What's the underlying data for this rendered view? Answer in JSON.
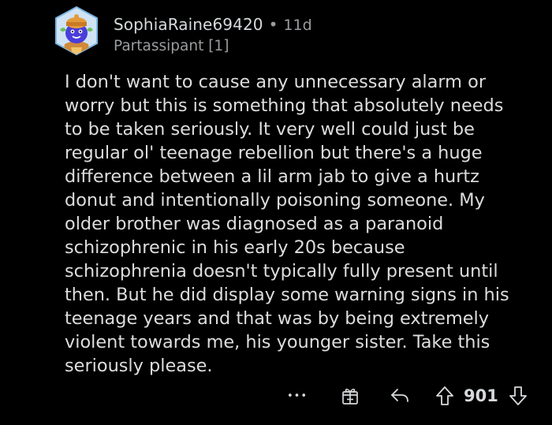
{
  "comment": {
    "username": "SophiaRaine69420",
    "separator": "•",
    "age": "11d",
    "flair": "Partassipant [1]",
    "body_lines": [
      "I don't want to cause any unnecessary alarm or",
      "worry but this is something that absolutely needs",
      "to be taken seriously. It very well could just be",
      "regular ol' teenage rebellion but there's a huge",
      "difference between a lil arm jab to give a hurtz",
      "donut and intentionally poisoning someone. My",
      "older brother was diagnosed as a paranoid",
      "schizophrenic in his early 20s because",
      "schizophrenia doesn't typically fully present until",
      "then. But he did display some warning signs in his",
      "teenage years and that was by being extremely",
      "violent towards me, his younger sister. Take this",
      "seriously please."
    ]
  },
  "actions": {
    "more_label": "•••",
    "score": "901",
    "icons": {
      "more": "more-options-icon",
      "award": "award-icon",
      "reply": "reply-icon",
      "upvote": "upvote-icon",
      "downvote": "downvote-icon"
    }
  },
  "colors": {
    "background": "#000000",
    "text_primary": "#d7dadc",
    "text_secondary": "#9a9c9f",
    "avatar_bg": "#cfe3f5",
    "avatar_border": "#7db6e0",
    "avatar_face": "#4a3ddb"
  }
}
